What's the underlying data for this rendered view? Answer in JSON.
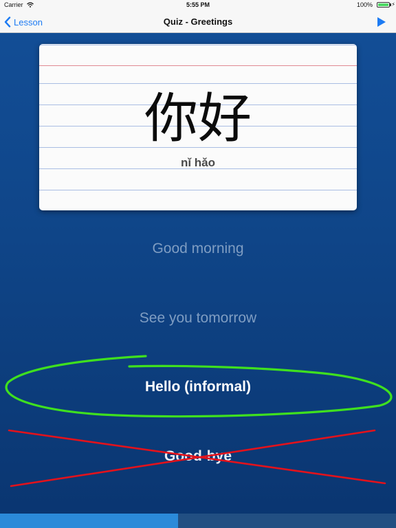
{
  "status_bar": {
    "carrier": "Carrier",
    "time": "5:55 PM",
    "battery_percent": "100%",
    "icons": [
      "wifi-icon",
      "battery-icon",
      "charging-icon"
    ]
  },
  "nav": {
    "back_label": "Lesson",
    "title": "Quiz - Greetings",
    "back_icon": "chevron-left-icon",
    "action_icon": "play-icon",
    "accent_color": "#1d7bf3"
  },
  "card": {
    "hanzi": "你好",
    "pinyin": "nǐ hǎo"
  },
  "answers": [
    {
      "label": "Good morning",
      "state": "unselected"
    },
    {
      "label": "See you tomorrow",
      "state": "unselected"
    },
    {
      "label": "Hello (informal)",
      "state": "correct",
      "mark": "circle",
      "mark_color": "#3fe01f"
    },
    {
      "label": "Good-bye",
      "state": "incorrect",
      "mark": "cross",
      "mark_color": "#e3121b"
    }
  ],
  "progress": {
    "fraction": 0.45,
    "fill_color": "#2b8ad9",
    "track_color": "#224f82"
  }
}
